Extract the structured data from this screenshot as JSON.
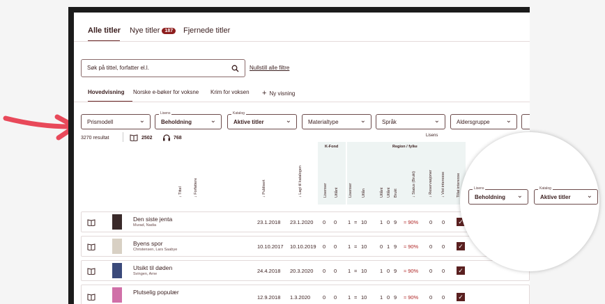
{
  "tabs": [
    {
      "label": "Alle titler"
    },
    {
      "label": "Nye titler",
      "badge": "187"
    },
    {
      "label": "Fjernede titler"
    }
  ],
  "search": {
    "placeholder": "Søk på tittel, forfatter el.l.",
    "reset_link": "Nullstill alle filtre"
  },
  "views": [
    {
      "label": "Hovedvisning"
    },
    {
      "label": "Norske e-bøker for voksne"
    },
    {
      "label": "Krim for voksen"
    },
    {
      "label": "Ny visning"
    }
  ],
  "filters": [
    {
      "legend": "",
      "value": "Prismodell"
    },
    {
      "legend": "Lisens",
      "value": "Beholdning"
    },
    {
      "legend": "Katalog",
      "value": "Aktive titler"
    },
    {
      "legend": "",
      "value": "Materialtype"
    },
    {
      "legend": "",
      "value": "Språk"
    },
    {
      "legend": "",
      "value": "Aldersgruppe"
    }
  ],
  "summary": {
    "results": "3270 resultat",
    "books": "2502",
    "audio": "768"
  },
  "groups": {
    "kfond": "K-Fond",
    "region": "Region / fylke",
    "lisens": "Lisens"
  },
  "columns": {
    "tittel": "Tittel",
    "forfattere": "Forfattere",
    "publisert": "Publisert",
    "lagt_til": "Lagt til katalogen",
    "lisenser1": "Lisenser",
    "utlant1": "Utlånt",
    "lisenser2": "Lisenser",
    "utlan": "Utlån",
    "utlant2": "Utlånt",
    "utlant3": "Utlånt",
    "brukt": "Brukt",
    "status": "Status (Brukt)",
    "reservasjoner": "Reservasjoner",
    "vist_interesse": "Vist interesse",
    "tillat_interesse": "Tillat interesse"
  },
  "arrow_glyph": "↓",
  "rows": [
    {
      "title": "Den siste jenta",
      "author": "Murad, Nadia",
      "pub": "23.1.2018",
      "added": "23.1.2020",
      "kf_lis": "0",
      "kf_utl": "0",
      "lis": "1",
      "utlan": "10",
      "u1": "1",
      "u2": "0",
      "u3": "9",
      "pct": "90%",
      "res": "0",
      "vist": "0",
      "cover": "#3a2a2a"
    },
    {
      "title": "Byens spor",
      "author": "Christensen, Lars Saabye",
      "pub": "10.10.2017",
      "added": "10.10.2019",
      "kf_lis": "0",
      "kf_utl": "0",
      "lis": "1",
      "utlan": "10",
      "u1": "0",
      "u2": "1",
      "u3": "9",
      "pct": "90%",
      "res": "0",
      "vist": "0",
      "cover": "#d8d0c4"
    },
    {
      "title": "Utsikt til døden",
      "author": "Svingen, Arne",
      "pub": "24.4.2018",
      "added": "20.3.2020",
      "kf_lis": "0",
      "kf_utl": "0",
      "lis": "1",
      "utlan": "10",
      "u1": "1",
      "u2": "0",
      "u3": "9",
      "pct": "90%",
      "res": "0",
      "vist": "0",
      "cover": "#3b4a7a"
    },
    {
      "title": "Plutselig populær",
      "author": "",
      "pub": "12.9.2018",
      "added": "1.3.2020",
      "kf_lis": "0",
      "kf_utl": "0",
      "lis": "1",
      "utlan": "10",
      "u1": "1",
      "u2": "0",
      "u3": "9",
      "pct": "90%",
      "res": "0",
      "vist": "0",
      "cover": "#d070a8"
    }
  ],
  "equals": "=",
  "approx": "≈",
  "check": "✓",
  "zoom": {
    "lisens_legend": "Lisens",
    "lisens_value": "Beholdning",
    "katalog_legend": "Katalog",
    "katalog_value": "Aktive titler"
  },
  "colors": {
    "accent": "#6b2a2a",
    "badge": "#8e1e1e",
    "alert": "#b02828",
    "arrow": "#e8495a"
  }
}
